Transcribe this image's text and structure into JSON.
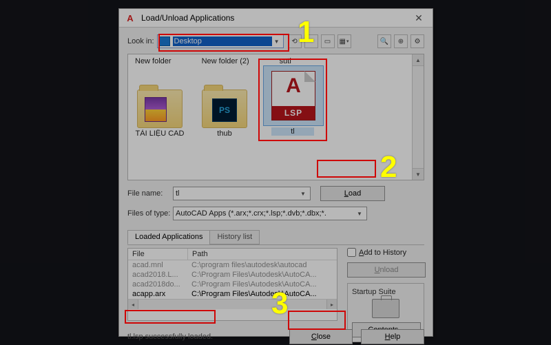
{
  "title": "Load/Unload Applications",
  "lookin": {
    "label": "Look in:",
    "value": "Desktop"
  },
  "toolbar_icons": [
    "back-icon",
    "up-icon",
    "new-folder-icon",
    "views-icon"
  ],
  "right_icons": [
    "find-file-icon",
    "add-favorite-icon",
    "tools-icon"
  ],
  "browser": {
    "top_labels": [
      "New folder",
      "New folder (2)",
      "suti"
    ],
    "items": [
      {
        "name": "TÀI LIỆU CAD",
        "kind": "folder-rar"
      },
      {
        "name": "thub",
        "kind": "folder-ps"
      },
      {
        "name": "tl",
        "kind": "lsp",
        "selected": true
      }
    ]
  },
  "file_row": {
    "label": "File name:",
    "value": "tl",
    "load_btn": "Load"
  },
  "type_row": {
    "label": "Files of type:",
    "value": "AutoCAD Apps (*.arx;*.crx;*.lsp;*.dvb;*.dbx;*."
  },
  "tabs": {
    "loaded": "Loaded Applications",
    "history": "History list"
  },
  "table": {
    "headers": {
      "file": "File",
      "path": "Path"
    },
    "rows": [
      {
        "file": "acad.mnl",
        "path": "C:\\program files\\autodesk\\autocad",
        "current": false
      },
      {
        "file": "acad2018.L...",
        "path": "C:\\Program Files\\Autodesk\\AutoCA...",
        "current": false
      },
      {
        "file": "acad2018do...",
        "path": "C:\\Program Files\\Autodesk\\AutoCA...",
        "current": false
      },
      {
        "file": "acapp.arx",
        "path": "C:\\Program Files\\Autodesk\\AutoCA...",
        "current": true
      }
    ]
  },
  "side": {
    "add_history": "Add to History",
    "unload": "Unload",
    "startup_title": "Startup Suite",
    "contents": "Contents..."
  },
  "status": "tl.lsp successfully loaded.",
  "buttons": {
    "close": "Close",
    "help": "Help"
  },
  "annot": {
    "n1": "1",
    "n2": "2",
    "n3": "3"
  },
  "lsp_badge": "LSP"
}
